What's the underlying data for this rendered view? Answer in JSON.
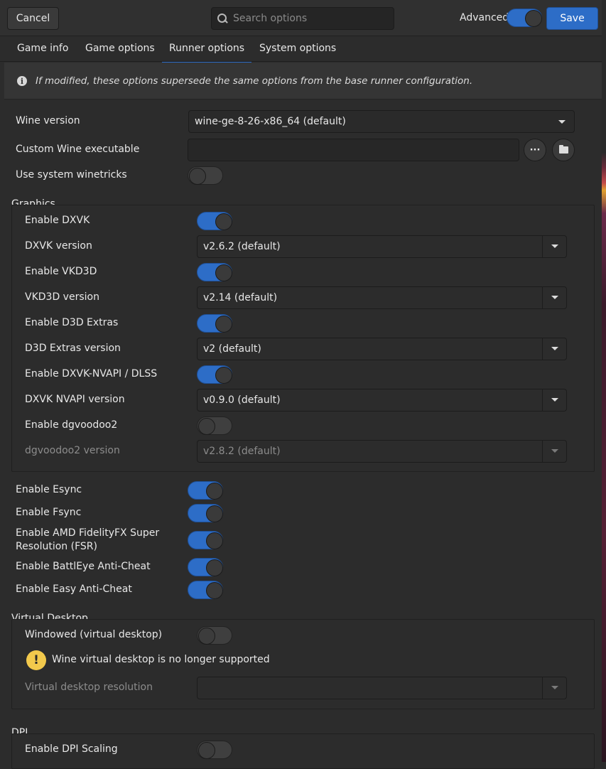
{
  "header": {
    "cancel_label": "Cancel",
    "search_placeholder": "Search options",
    "advanced_label": "Advanced",
    "advanced_on": true,
    "save_label": "Save"
  },
  "tabs": [
    {
      "label": "Game info",
      "active": false
    },
    {
      "label": "Game options",
      "active": false
    },
    {
      "label": "Runner options",
      "active": true
    },
    {
      "label": "System options",
      "active": false
    }
  ],
  "info_banner": {
    "icon": "info-icon",
    "text": "If modified, these options supersede the same options from the base runner configuration."
  },
  "wine": {
    "version_label": "Wine version",
    "version_value": "wine-ge-8-26-x86_64 (default)",
    "custom_exe_label": "Custom Wine executable",
    "custom_exe_value": "",
    "more_button": "···",
    "winetricks_label": "Use system winetricks",
    "winetricks_on": false
  },
  "graphics": {
    "title": "Graphics",
    "dxvk_label": "Enable DXVK",
    "dxvk_on": true,
    "dxvk_version_label": "DXVK version",
    "dxvk_version_value": "v2.6.2 (default)",
    "vkd3d_label": "Enable VKD3D",
    "vkd3d_on": true,
    "vkd3d_version_label": "VKD3D version",
    "vkd3d_version_value": "v2.14 (default)",
    "d3d_extras_label": "Enable D3D Extras",
    "d3d_extras_on": true,
    "d3d_extras_version_label": "D3D Extras version",
    "d3d_extras_version_value": "v2 (default)",
    "nvapi_label": "Enable DXVK-NVAPI / DLSS",
    "nvapi_on": true,
    "nvapi_version_label": "DXVK NVAPI version",
    "nvapi_version_value": "v0.9.0 (default)",
    "dgvoodoo_label": "Enable dgvoodoo2",
    "dgvoodoo_on": false,
    "dgvoodoo_version_label": "dgvoodoo2 version",
    "dgvoodoo_version_value": "v2.8.2 (default)"
  },
  "sync": {
    "esync_label": "Enable Esync",
    "esync_on": true,
    "fsync_label": "Enable Fsync",
    "fsync_on": true,
    "fsr_label_line1": "Enable AMD FidelityFX Super",
    "fsr_label_line2": "Resolution (FSR)",
    "fsr_on": true,
    "battleye_label": "Enable BattlEye Anti-Cheat",
    "battleye_on": true,
    "eac_label": "Enable Easy Anti-Cheat",
    "eac_on": true
  },
  "virtual_desktop": {
    "title": "Virtual Desktop",
    "windowed_label": "Windowed (virtual desktop)",
    "windowed_on": false,
    "warning_icon": "warning-icon",
    "warning_text": "Wine virtual desktop is no longer supported",
    "resolution_label": "Virtual desktop resolution",
    "resolution_value": ""
  },
  "dpi": {
    "title": "DPI",
    "scaling_label": "Enable DPI Scaling",
    "scaling_on": false
  },
  "colors": {
    "accent": "#2d6dc7",
    "background": "#2c2c2c",
    "warning": "#f2c94c"
  }
}
